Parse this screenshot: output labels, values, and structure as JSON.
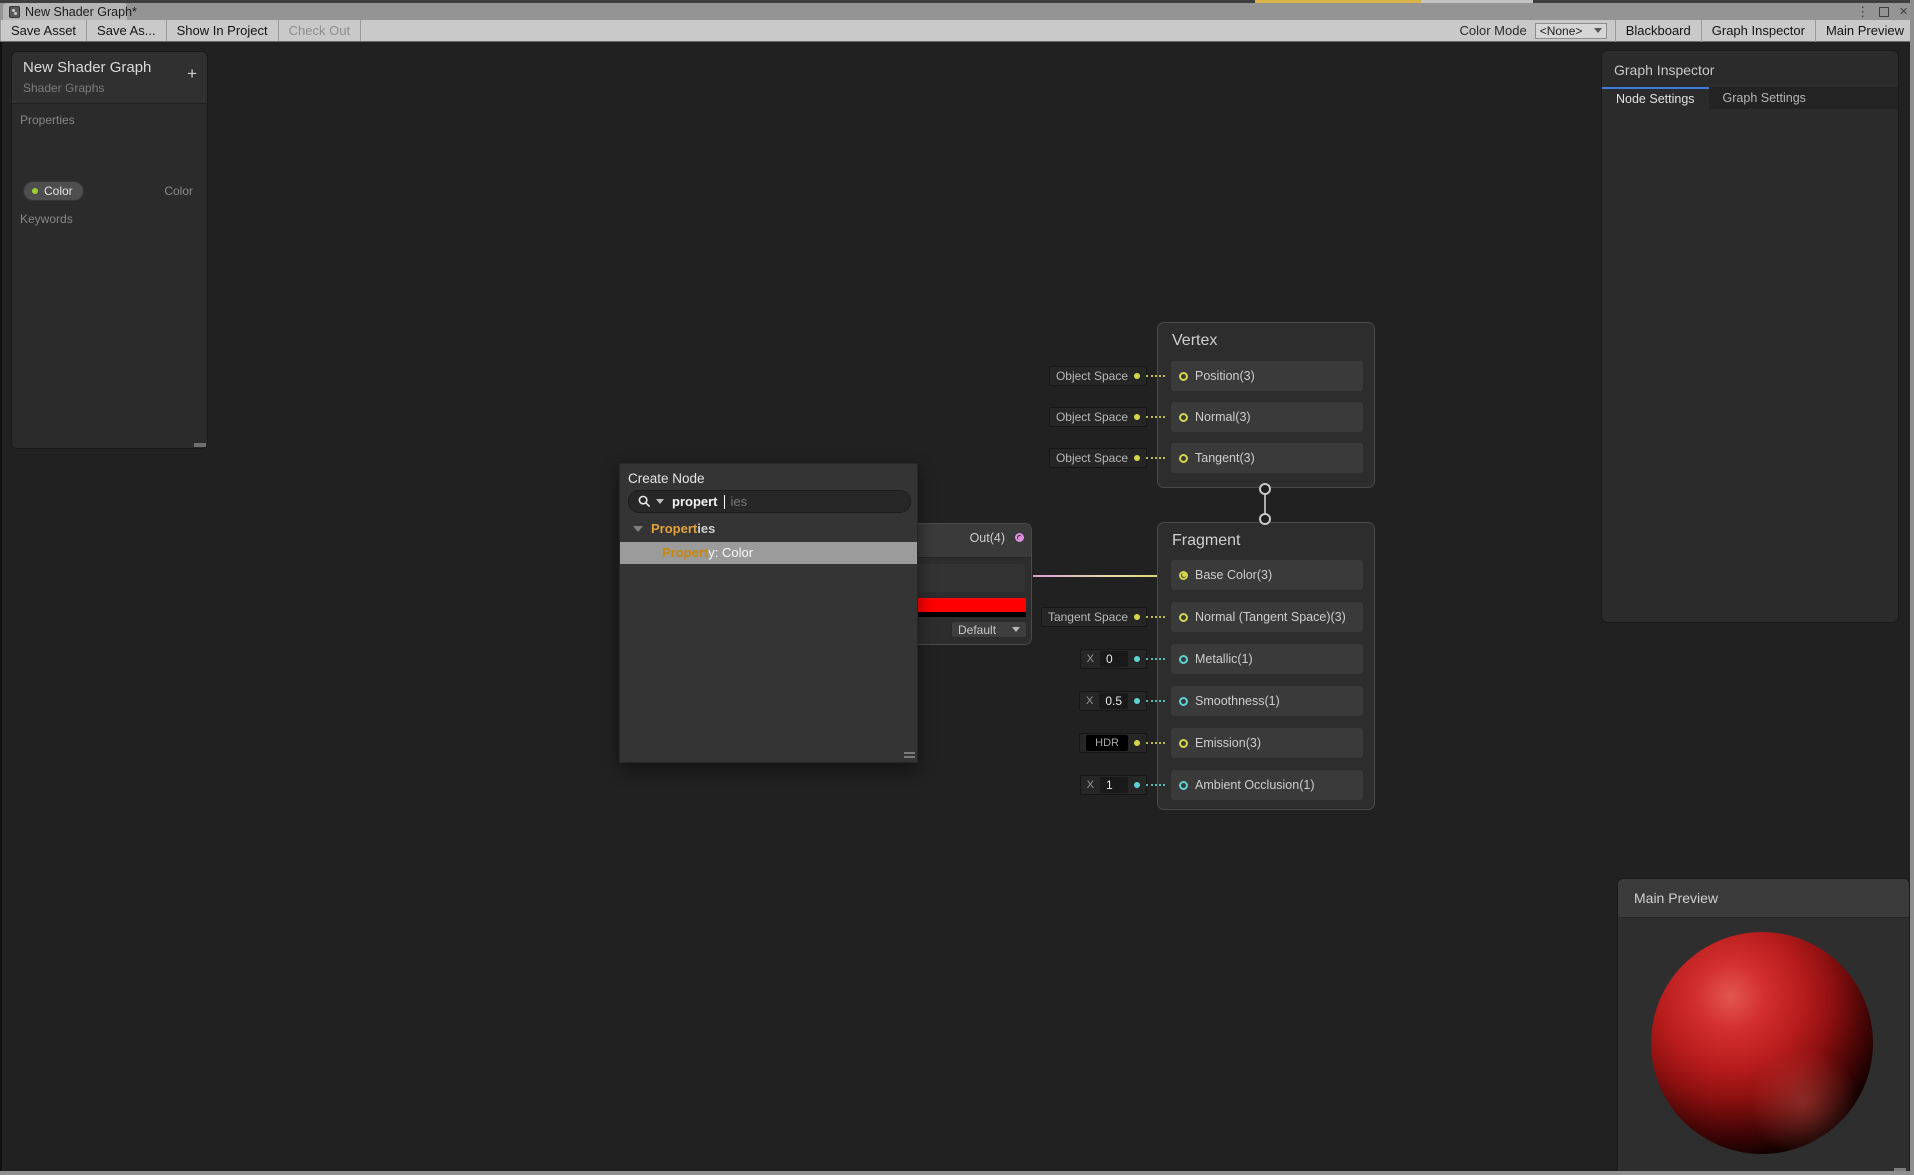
{
  "window": {
    "tab_title": "New Shader Graph*",
    "controls": {
      "menu": "⋮",
      "close": "×"
    }
  },
  "toolbar": {
    "left_buttons": [
      {
        "label": "Save Asset",
        "disabled": false
      },
      {
        "label": "Save As...",
        "disabled": false
      },
      {
        "label": "Show In Project",
        "disabled": false
      },
      {
        "label": "Check Out",
        "disabled": true
      }
    ],
    "color_mode_label": "Color Mode",
    "color_mode_value": "<None>",
    "right_buttons": [
      "Blackboard",
      "Graph Inspector",
      "Main Preview"
    ]
  },
  "blackboard": {
    "title": "New Shader Graph",
    "subtitle": "Shader Graphs",
    "add_label": "+",
    "properties_label": "Properties",
    "keywords_label": "Keywords",
    "property": {
      "name": "Color",
      "type": "Color"
    }
  },
  "inspector": {
    "title": "Graph Inspector",
    "tabs": [
      {
        "label": "Node Settings",
        "active": true
      },
      {
        "label": "Graph Settings",
        "active": false
      }
    ]
  },
  "preview": {
    "title": "Main Preview"
  },
  "create_node": {
    "title": "Create Node",
    "search": {
      "typed": "propert",
      "ghost": "ies"
    },
    "category": {
      "match": "Propert",
      "rest": "ies"
    },
    "result": {
      "match": "Propert",
      "rest": "y: Color"
    }
  },
  "nodes": {
    "vertex": {
      "title": "Vertex",
      "rows": [
        {
          "label": "Position(3)",
          "port": "vec3",
          "connected": false,
          "control": {
            "kind": "space",
            "text": "Object Space"
          }
        },
        {
          "label": "Normal(3)",
          "port": "vec3",
          "connected": false,
          "control": {
            "kind": "space",
            "text": "Object Space"
          }
        },
        {
          "label": "Tangent(3)",
          "port": "vec3",
          "connected": false,
          "control": {
            "kind": "space",
            "text": "Object Space"
          }
        }
      ]
    },
    "fragment": {
      "title": "Fragment",
      "rows": [
        {
          "label": "Base Color(3)",
          "port": "vec3",
          "connected": true,
          "control": null
        },
        {
          "label": "Normal (Tangent Space)(3)",
          "port": "vec3",
          "connected": false,
          "control": {
            "kind": "space",
            "text": "Tangent Space"
          }
        },
        {
          "label": "Metallic(1)",
          "port": "vec1",
          "connected": false,
          "control": {
            "kind": "field",
            "x": "X",
            "value": "0"
          }
        },
        {
          "label": "Smoothness(1)",
          "port": "vec1",
          "connected": false,
          "control": {
            "kind": "field",
            "x": "X",
            "value": "0.5"
          }
        },
        {
          "label": "Emission(3)",
          "port": "vec3",
          "connected": false,
          "control": {
            "kind": "hdr",
            "text": "HDR"
          }
        },
        {
          "label": "Ambient Occlusion(1)",
          "port": "vec1",
          "connected": false,
          "control": {
            "kind": "field",
            "x": "X",
            "value": "1"
          }
        }
      ]
    },
    "color_node": {
      "out_label": "Out(4)",
      "mode": "Default",
      "swatch_color": "#ff0000"
    }
  },
  "colors": {
    "vec1": "#5fd3d3",
    "vec3": "#d6d64c",
    "vec4": "#de8fde",
    "accent": "#3c7bd6",
    "highlight": "#e3a23c",
    "swatch": "#ff0000"
  }
}
